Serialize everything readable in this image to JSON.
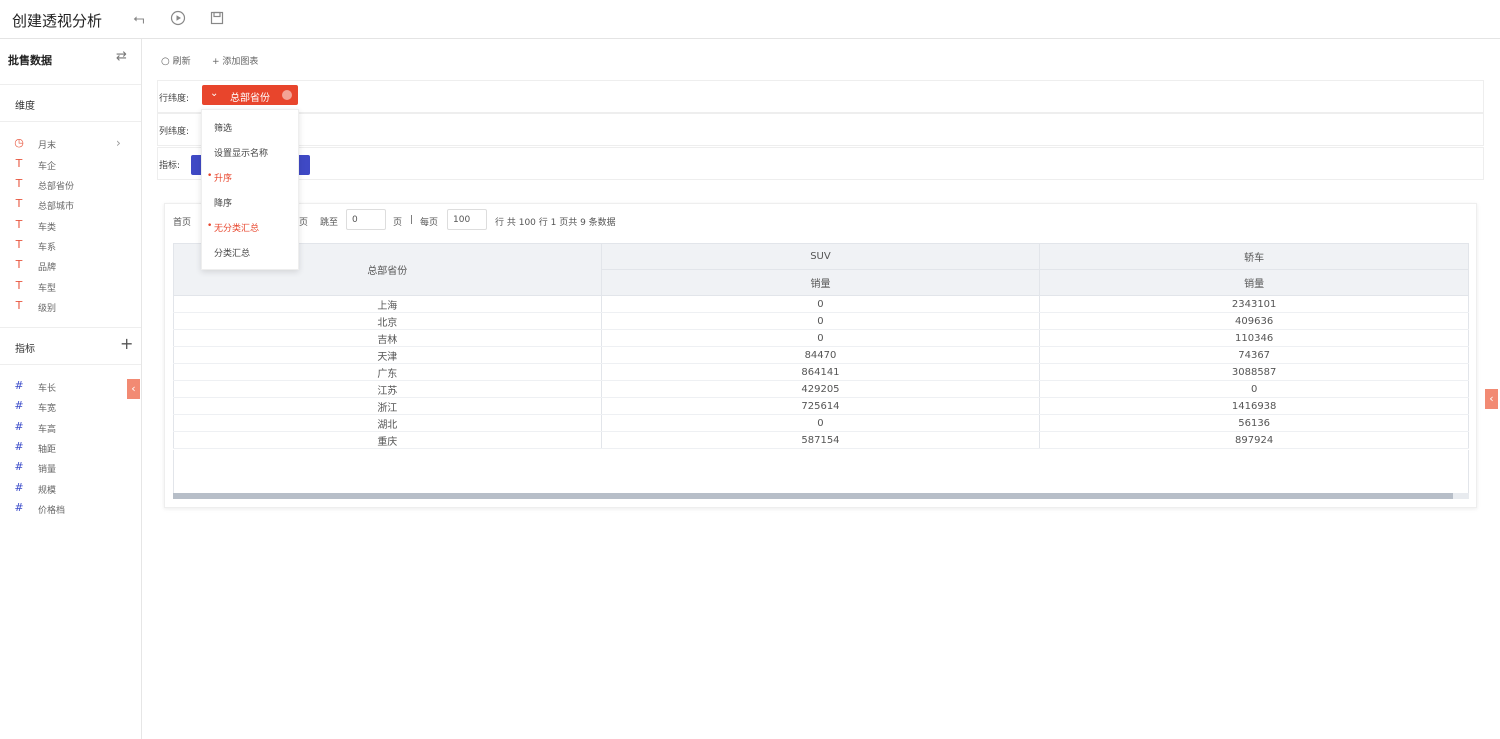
{
  "header": {
    "title": "创建透视分析"
  },
  "sidebar": {
    "dataset_name": "批售数据",
    "dimensions_label": "维度",
    "dimensions": [
      {
        "label": "月末",
        "icon": "clock-icon"
      },
      {
        "label": "车企",
        "icon": "text-type-icon"
      },
      {
        "label": "总部省份",
        "icon": "text-type-icon"
      },
      {
        "label": "总部城市",
        "icon": "text-type-icon"
      },
      {
        "label": "车类",
        "icon": "text-type-icon"
      },
      {
        "label": "车系",
        "icon": "text-type-icon"
      },
      {
        "label": "品牌",
        "icon": "text-type-icon"
      },
      {
        "label": "车型",
        "icon": "text-type-icon"
      },
      {
        "label": "级别",
        "icon": "text-type-icon"
      }
    ],
    "metrics_label": "指标",
    "metrics": [
      {
        "label": "车长",
        "icon": "number-type-icon"
      },
      {
        "label": "车宽",
        "icon": "number-type-icon"
      },
      {
        "label": "车高",
        "icon": "number-type-icon"
      },
      {
        "label": "轴距",
        "icon": "number-type-icon"
      },
      {
        "label": "销量",
        "icon": "number-type-icon"
      },
      {
        "label": "规模",
        "icon": "number-type-icon"
      },
      {
        "label": "价格档",
        "icon": "number-type-icon"
      }
    ]
  },
  "toolbar": {
    "refresh": "刷新",
    "add_chart": "添加图表"
  },
  "config": {
    "row_label": "行纬度:",
    "row_chip": "总部省份",
    "col_label": "列纬度:",
    "metric_label": "指标:"
  },
  "menu": {
    "items": [
      {
        "label": "筛选",
        "active": false
      },
      {
        "label": "设置显示名称",
        "active": false
      },
      {
        "label": "升序",
        "active": true
      },
      {
        "label": "降序",
        "active": false
      },
      {
        "label": "无分类汇总",
        "active": true
      },
      {
        "label": "分类汇总",
        "active": false
      }
    ]
  },
  "pagination": {
    "first": "首页",
    "last_partial": "页",
    "jump_label": "跳至",
    "jump_value": "0",
    "page_unit": "页",
    "sep": "|",
    "per_page_label": "每页",
    "per_page_value": "100",
    "summary": "行 共 100 行 1 页共 9 条数据"
  },
  "table": {
    "row_header": "总部省份",
    "col_groups": [
      "SUV",
      "轿车"
    ],
    "sub_headers": [
      "销量",
      "销量"
    ],
    "rows": [
      [
        "上海",
        "0",
        "2343101"
      ],
      [
        "北京",
        "0",
        "409636"
      ],
      [
        "吉林",
        "0",
        "110346"
      ],
      [
        "天津",
        "84470",
        "74367"
      ],
      [
        "广东",
        "864141",
        "3088587"
      ],
      [
        "江苏",
        "429205",
        "0"
      ],
      [
        "浙江",
        "725614",
        "1416938"
      ],
      [
        "湖北",
        "0",
        "56136"
      ],
      [
        "重庆",
        "587154",
        "897924"
      ]
    ]
  },
  "colors": {
    "accent": "#e8452c",
    "metric_chip": "#3f49c5"
  }
}
